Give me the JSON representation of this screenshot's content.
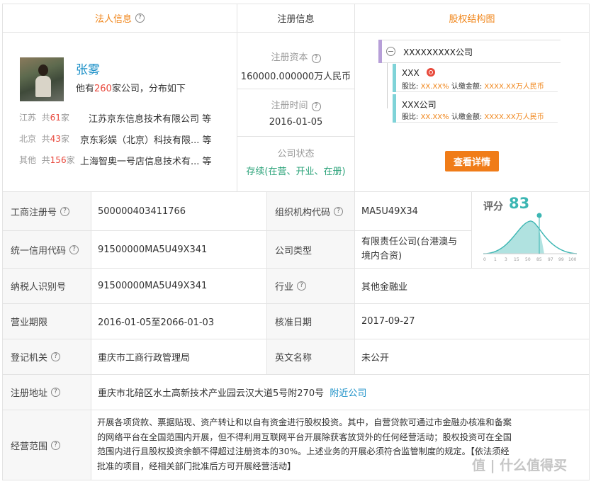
{
  "tabs": {
    "legal": "法人信息",
    "registration": "注册信息",
    "equity": "股权结构图"
  },
  "person": {
    "name": "张雾",
    "summary_pre": "他有",
    "summary_count": "260",
    "summary_post": "家公司，分布如下",
    "regions": [
      {
        "region": "江苏",
        "prefix": "共",
        "count": "61",
        "unit": "家",
        "company": "江苏京东信息技术有限公司",
        "suffix": "等"
      },
      {
        "region": "北京",
        "prefix": "共",
        "count": "43",
        "unit": "家",
        "company": "京东彩娱（北京）科技有限...",
        "suffix": "等"
      },
      {
        "region": "其他",
        "prefix": "共",
        "count": "156",
        "unit": "家",
        "company": "上海智奥一号店信息技术有...",
        "suffix": "等"
      }
    ]
  },
  "registration": {
    "capital_label": "注册资本",
    "capital_value": "160000.000000万人民币",
    "time_label": "注册时间",
    "time_value": "2016-01-05",
    "status_label": "公司状态",
    "status_value": "存续(在营、开业、在册)"
  },
  "equity": {
    "root": "XXXXXXXXX公司",
    "collapse_symbol": "−",
    "holders": [
      {
        "name": "XXX",
        "ratio_label": "股比:",
        "ratio": "XX.XX%",
        "amount_label": "认缴金额:",
        "amount": "XXXX.XX万人民币"
      },
      {
        "name": "XXX公司",
        "ratio_label": "股比:",
        "ratio": "XX.XX%",
        "amount_label": "认缴金额:",
        "amount": "XXXX.XX万人民币"
      }
    ],
    "detail_button": "查看详情"
  },
  "score": {
    "label": "评分",
    "value": "83",
    "axis": [
      "0",
      "1",
      "3",
      "15",
      "50",
      "85",
      "97",
      "99",
      "100"
    ],
    "color": "#3cb6b3"
  },
  "details": {
    "reg_no_label": "工商注册号",
    "reg_no": "500000403411766",
    "org_code_label": "组织机构代码",
    "org_code": "MA5U49X34",
    "credit_label": "统一信用代码",
    "credit": "91500000MA5U49X341",
    "type_label": "公司类型",
    "type_line1": "有限责任公司(台港澳与",
    "type_line2": "境内合资)",
    "tax_label": "纳税人识别号",
    "tax": "91500000MA5U49X341",
    "industry_label": "行业",
    "industry": "其他金融业",
    "term_label": "营业期限",
    "term": "2016-01-05至2066-01-03",
    "approve_label": "核准日期",
    "approve": "2017-09-27",
    "authority_label": "登记机关",
    "authority": "重庆市工商行政管理局",
    "english_label": "英文名称",
    "english": "未公开",
    "address_label": "注册地址",
    "address": "重庆市北碚区水土高新技术产业园云汉大道5号附270号",
    "nearby": "附近公司",
    "scope_label": "经营范围",
    "scope_lines": [
      "开展各项贷款、票据贴现、资产转让和以自有资金进行股权投资。其中，自营贷款可通过市金融办核准和备案",
      "的网络平台在全国范围内开展，但不得利用互联网平台开展除获客放贷外的任何经营活动；股权投资可在全国",
      "范围内进行且股权投资余额不得超过注册资本的30%。上述业务的开展必须符合监管制度的规定。【依法须经",
      "批准的项目，经相关部门批准后方可开展经营活动】"
    ]
  },
  "watermark": "值 | 什么值得买"
}
